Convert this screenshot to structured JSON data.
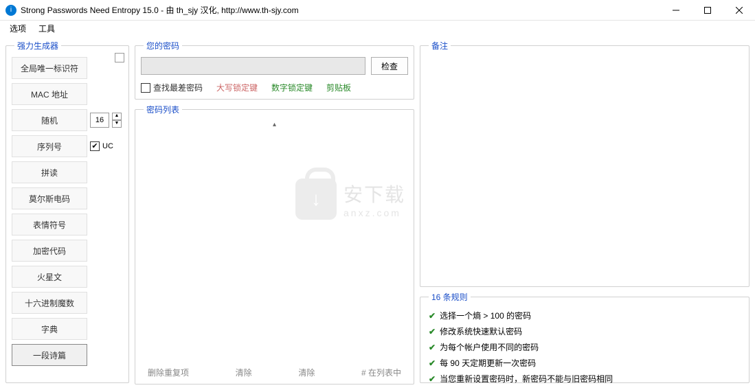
{
  "window": {
    "title": "Strong Passwords Need Entropy 15.0 - 由 th_sjy 汉化, http://www.th-sjy.com"
  },
  "menu": {
    "options": "选项",
    "tools": "工具"
  },
  "generator": {
    "legend": "强力生成器",
    "buttons": {
      "guid": "全局唯一标识符",
      "mac": "MAC 地址",
      "random": "随机",
      "serial": "序列号",
      "pinyin": "拼读",
      "morse": "莫尔斯电码",
      "emoji": "表情符号",
      "crypto": "加密代码",
      "martian": "火星文",
      "hexmagic": "十六进制魔数",
      "dict": "字典",
      "poem": "一段诗篇"
    },
    "random_len": "16",
    "uc_label": "UC"
  },
  "your_password": {
    "legend": "您的密码",
    "check_btn": "检查",
    "find_worst": "查找最差密码",
    "caps_lock": "大写锁定键",
    "num_lock": "数字锁定键",
    "clipboard": "剪贴板"
  },
  "password_list": {
    "legend": "密码列表",
    "remove_dup": "删除重复项",
    "clear1": "清除",
    "clear2": "清除",
    "count_suffix": "# 在列表中"
  },
  "notes": {
    "legend": "备注"
  },
  "rules": {
    "legend": "16 条规则",
    "items": [
      "选择一个熵 > 100 的密码",
      "修改系统快速默认密码",
      "为每个帐户使用不同的密码",
      "每 90 天定期更新一次密码",
      "当您重新设置密码时，新密码不能与旧密码相同"
    ]
  },
  "watermark": {
    "big": "安下载",
    "small": "anxz.com"
  }
}
